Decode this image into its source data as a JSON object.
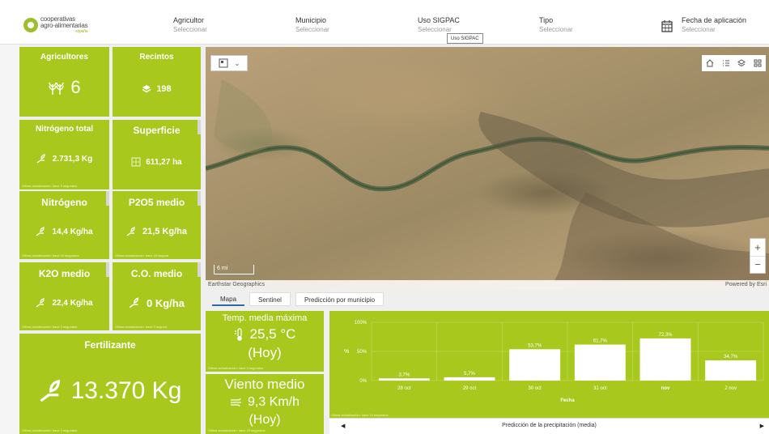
{
  "header": {
    "logo": {
      "line1": "cooperativas",
      "line2": "agro-alimentarias",
      "line3": "españa"
    },
    "filters": [
      {
        "label": "Agricultor",
        "value": "Seleccionar"
      },
      {
        "label": "Municipio",
        "value": "Seleccionar"
      },
      {
        "label": "Uso SIGPAC",
        "value": "Seleccionar"
      },
      {
        "label": "Tipo",
        "value": "Seleccionar"
      },
      {
        "label": "Fecha de aplicación",
        "value": "Seleccionar"
      }
    ],
    "tooltip": "Uso SIGPAC"
  },
  "tiles": {
    "agricultores": {
      "title": "Agricultores",
      "value": "6",
      "icon": "wheat-icon"
    },
    "recintos": {
      "title": "Recintos",
      "value": "198",
      "icon": "layers-icon"
    },
    "nitrogeno_total": {
      "title": "Nitrógeno total",
      "value": "2.731,3 Kg",
      "icon": "hand-plant-icon"
    },
    "superficie": {
      "title": "Superficie",
      "value": "611,27 ha",
      "icon": "area-icon"
    },
    "nitrogeno": {
      "title": "Nitrógeno",
      "value": "14,4 Kg/ha",
      "icon": "hand-plant-icon"
    },
    "p2o5": {
      "title": "P2O5 medio",
      "value": "21,5 Kg/ha",
      "icon": "hand-plant-icon"
    },
    "k2o": {
      "title": "K2O medio",
      "value": "22,4 Kg/ha",
      "icon": "hand-plant-icon"
    },
    "co": {
      "title": "C.O. medio",
      "value": "0 Kg/ha",
      "icon": "hand-plant-icon"
    },
    "fertilizante": {
      "title": "Fertilizante",
      "value": "13.370 Kg",
      "icon": "hand-plant-icon"
    },
    "temp": {
      "title": "Temp. media máxima",
      "value": "25,5 °C",
      "sub": "(Hoy)",
      "icon": "thermometer-icon"
    },
    "viento": {
      "title": "Viento medio",
      "value": "9,3 Km/h",
      "sub": "(Hoy)",
      "icon": "wind-icon"
    }
  },
  "footers": {
    "f3": "Última actualización: hace 3 segundos",
    "f15": "Última actualización: hace 15 segundos",
    "f14": "Última actualización: hace 14 segundos",
    "f3b": "Última actualización: hace 3 segund",
    "f15b": "Última actualización: hace 15 segund"
  },
  "map": {
    "scale": "6 mi",
    "attribution_left": "Earthstar Geographics",
    "attribution_right": "Powered by Esri"
  },
  "tabs": [
    "Mapa",
    "Sentinel",
    "Predicción por municipio"
  ],
  "chart_data": {
    "type": "bar",
    "categories": [
      "28 oct",
      "29 oct",
      "30 oct",
      "31 oct",
      "nov",
      "2 nov"
    ],
    "values": [
      3.7,
      5.7,
      53.7,
      61.7,
      72.3,
      34.7
    ],
    "labels": [
      "3,7%",
      "5,7%",
      "53,7%",
      "61,7%",
      "72,3%",
      "34,7%"
    ],
    "ylim": [
      0,
      100
    ],
    "yticks": [
      "0%",
      "50%",
      "100%"
    ],
    "ylabel": "%",
    "xlabel": "Fecha",
    "title": "Predicción de la precipitación (media)",
    "grid": true,
    "bar_color": "#ffffff"
  },
  "colors": {
    "tile": "#a8c81d",
    "accent": "#2f6ba8"
  }
}
